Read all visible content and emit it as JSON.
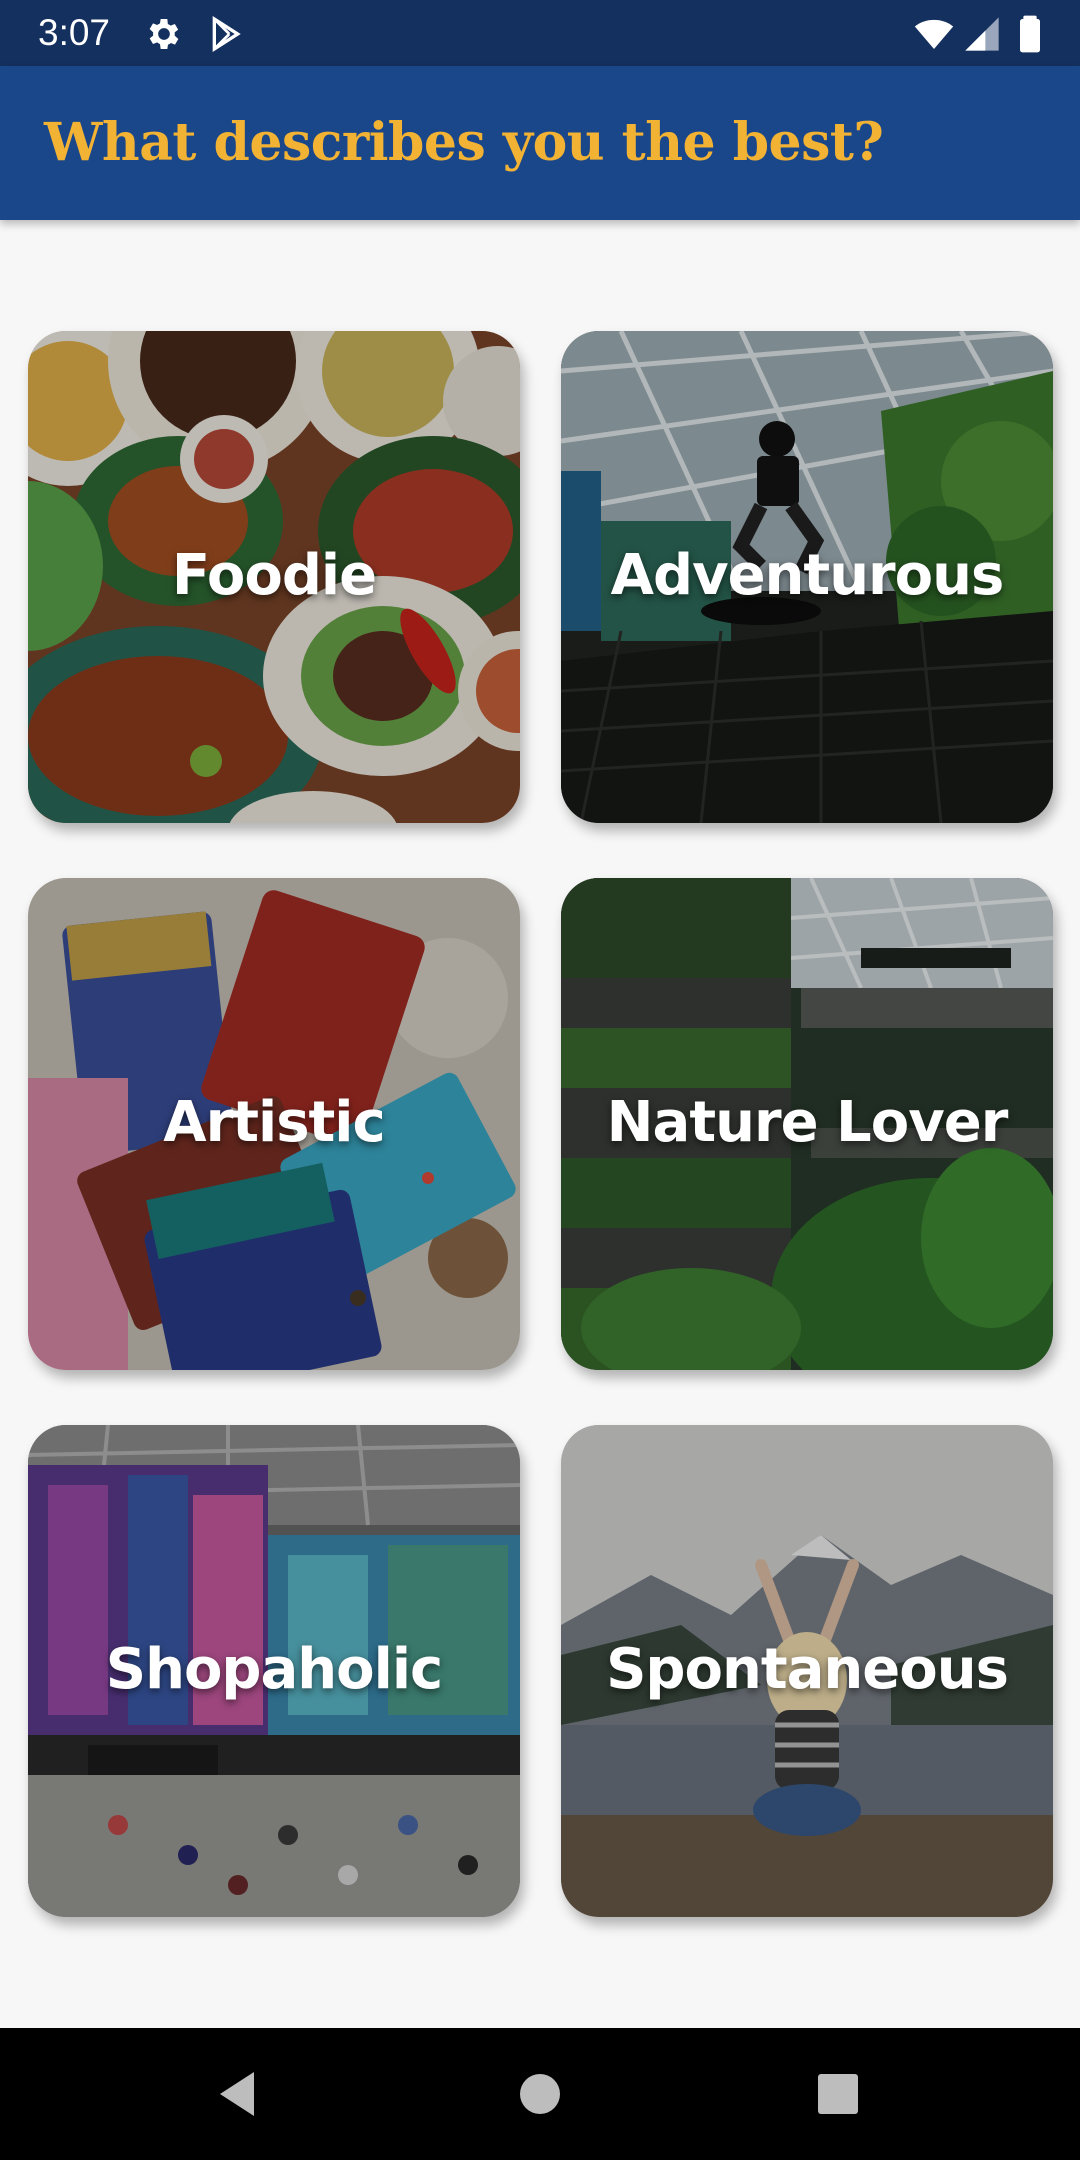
{
  "status_bar": {
    "time": "3:07",
    "icons": [
      "settings-icon",
      "play-store-icon",
      "wifi-icon",
      "signal-icon",
      "battery-icon"
    ]
  },
  "app_bar": {
    "title": "What describes you the best?",
    "background": "#1a468a",
    "title_color": "#f2b233"
  },
  "cards": [
    {
      "label": "Foodie"
    },
    {
      "label": "Adventurous"
    },
    {
      "label": "Artistic"
    },
    {
      "label": "Nature Lover"
    },
    {
      "label": "Shopaholic"
    },
    {
      "label": "Spontaneous"
    }
  ],
  "nav_bar": {
    "buttons": [
      "back-icon",
      "home-icon",
      "recents-icon"
    ]
  }
}
